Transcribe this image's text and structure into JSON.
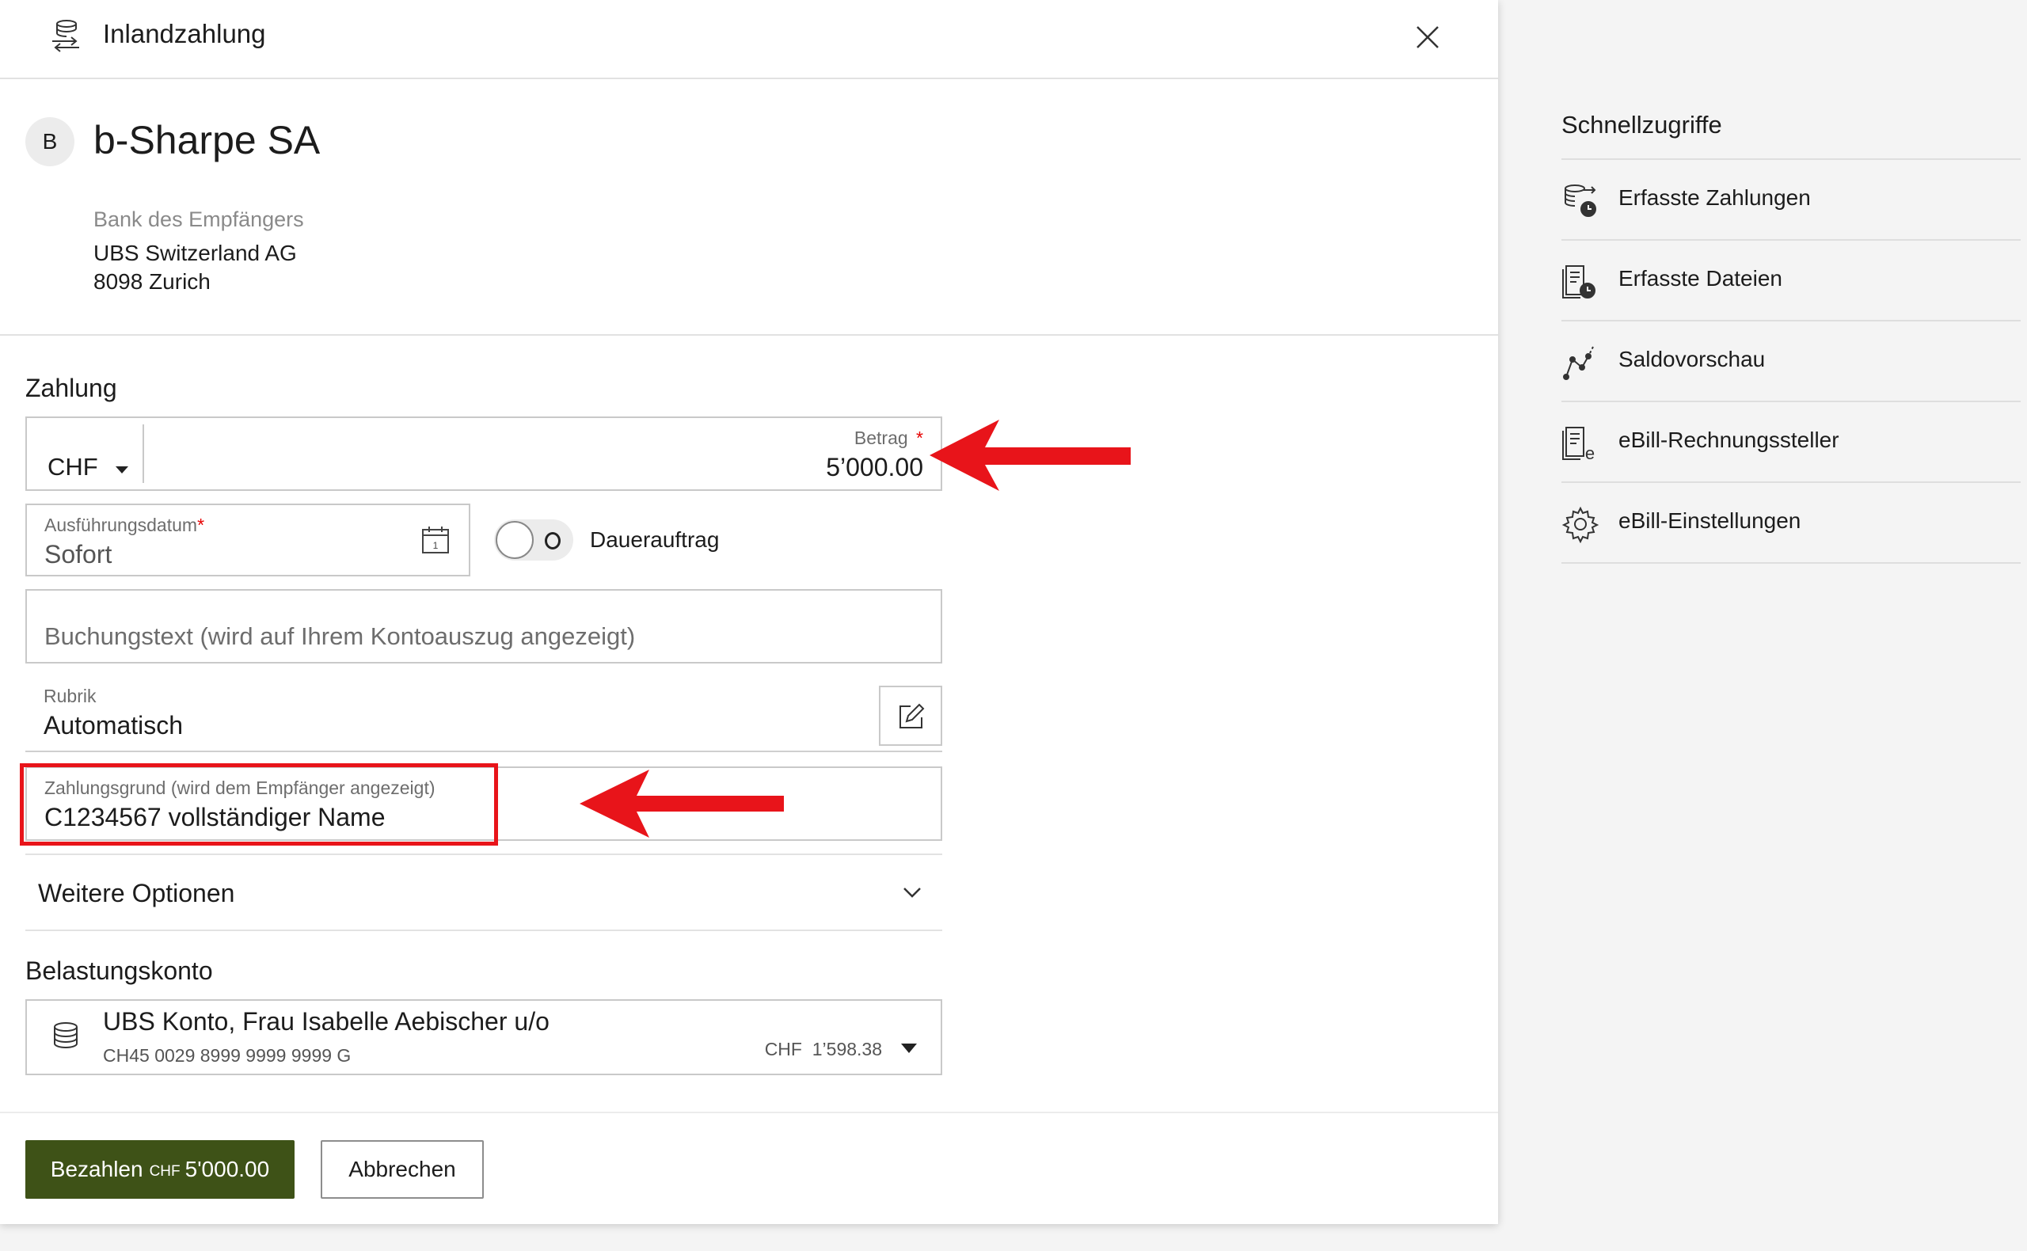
{
  "header": {
    "title": "Inlandzahlung"
  },
  "payee": {
    "initial": "B",
    "name": "b-Sharpe SA",
    "bank_label": "Bank des Empfängers",
    "bank_name": "UBS Switzerland AG",
    "bank_city": "8098 Zurich"
  },
  "payment": {
    "section_title": "Zahlung",
    "currency": "CHF",
    "amount_label": "Betrag",
    "amount_required": "*",
    "amount_value": "5’000.00",
    "date_label": "Ausführungsdatum",
    "date_required": "*",
    "date_value": "Sofort",
    "standing_order_label": "Dauerauftrag",
    "standing_order_on": false,
    "booking_text_placeholder": "Buchungstext (wird auf Ihrem Kontoauszug angezeigt)",
    "rubrik_label": "Rubrik",
    "rubrik_value": "Automatisch",
    "reason_label": "Zahlungsgrund (wird dem Empfänger angezeigt)",
    "reason_value": "C1234567 vollständiger Name",
    "more_options": "Weitere Optionen"
  },
  "debit": {
    "section_title": "Belastungskonto",
    "account_name": "UBS Konto, Frau Isabelle Aebischer u/o",
    "iban": "CH45 0029 8999 9999 9999 G",
    "balance_currency": "CHF",
    "balance": "1’598.38"
  },
  "footer": {
    "pay_label": "Bezahlen",
    "pay_currency": "CHF",
    "pay_amount": "5'000.00",
    "cancel_label": "Abbrechen"
  },
  "sidebar": {
    "title": "Schnellzugriffe",
    "items": [
      {
        "label": "Erfasste Zahlungen",
        "icon": "recorded-payments-icon"
      },
      {
        "label": "Erfasste Dateien",
        "icon": "recorded-files-icon"
      },
      {
        "label": "Saldovorschau",
        "icon": "balance-preview-icon"
      },
      {
        "label": "eBill-Rechnungssteller",
        "icon": "ebill-billers-icon"
      },
      {
        "label": "eBill-Einstellungen",
        "icon": "settings-gear-icon"
      }
    ]
  },
  "colors": {
    "primary_button": "#3e5217",
    "required": "#e60000",
    "annotation": "#e8141a"
  }
}
